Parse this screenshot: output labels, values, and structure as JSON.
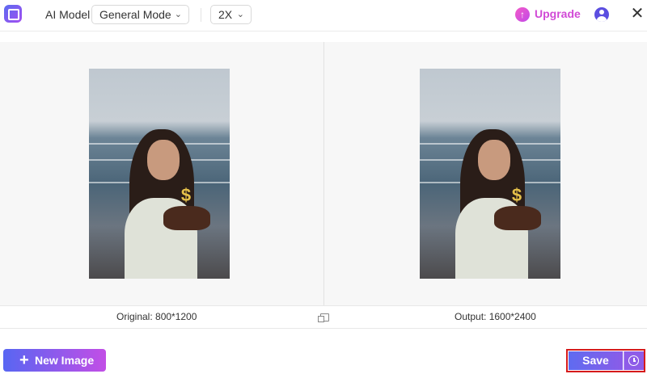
{
  "toolbar": {
    "ai_model_label": "AI Model",
    "mode_select": {
      "value": "General Mode"
    },
    "scale_select": {
      "value": "2X"
    },
    "upgrade_label": "Upgrade",
    "close_glyph": "✕"
  },
  "preview": {
    "original_label": "Original: 800*1200",
    "output_label": "Output: 1600*2400"
  },
  "footer": {
    "new_image_label": "New Image",
    "new_image_glyph": "+",
    "save_label": "Save"
  },
  "icons": {
    "app": "app-logo-icon",
    "mode_chevron": "chevron-down-icon",
    "scale_chevron": "chevron-down-icon",
    "upgrade": "arrow-up-circle-icon",
    "user": "user-avatar-icon",
    "close": "close-icon",
    "compare": "compare-icon",
    "history": "clock-icon"
  },
  "colors": {
    "brand_gradient_start": "#5866f2",
    "brand_gradient_end": "#c24ee6",
    "upgrade_text": "#d14ad6",
    "highlight_border": "#d61b1b"
  }
}
